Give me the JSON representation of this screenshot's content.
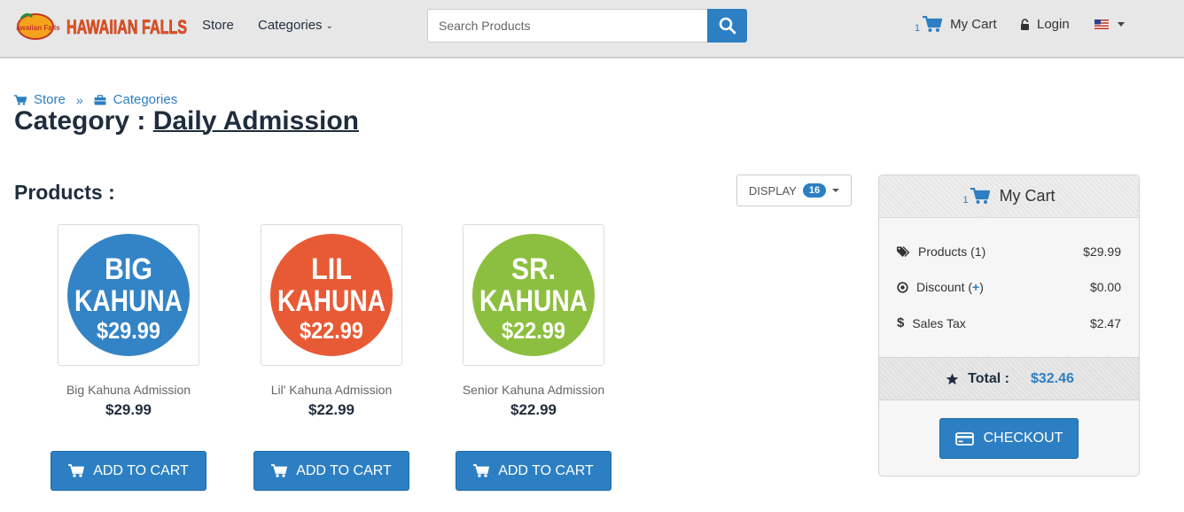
{
  "colors": {
    "accent": "#2c7fc2",
    "navbar_bg": "#e7e7e7",
    "big_kahuna": "#3384c6",
    "lil_kahuna": "#e85a35",
    "sr_kahuna": "#8cbf3f",
    "logo_text": "#e8531f"
  },
  "header": {
    "logo_text": "HAWAIIAN FALLS",
    "logo_badge": "Hawaiian Falls",
    "store_label": "Store",
    "categories_label": "Categories",
    "search_placeholder": "Search Products",
    "cart_count": "1",
    "cart_label": "My Cart",
    "login_label": "Login",
    "language_icon": "us-flag-icon"
  },
  "breadcrumb": {
    "store": "Store",
    "separator": "»",
    "categories": "Categories"
  },
  "page": {
    "title_prefix": "Category :",
    "category_name": "Daily Admission",
    "products_heading": "Products :",
    "display_label": "DISPLAY",
    "display_count": "16"
  },
  "products": [
    {
      "badge_line1": "BIG",
      "badge_line2": "KAHUNA",
      "badge_price": "$29.99",
      "name": "Big Kahuna Admission",
      "price": "$29.99",
      "button": "ADD TO CART"
    },
    {
      "badge_line1": "LIL",
      "badge_line2": "KAHUNA",
      "badge_price": "$22.99",
      "name": "Lil' Kahuna Admission",
      "price": "$22.99",
      "button": "ADD TO CART"
    },
    {
      "badge_line1": "SR.",
      "badge_line2": "KAHUNA",
      "badge_price": "$22.99",
      "name": "Senior Kahuna Admission",
      "price": "$22.99",
      "button": "ADD TO CART"
    }
  ],
  "cart": {
    "count": "1",
    "title": "My Cart",
    "products_label": "Products (1)",
    "products_value": "$29.99",
    "discount_label": "Discount (",
    "discount_plus": "+",
    "discount_close": ")",
    "discount_value": "$0.00",
    "tax_label": "Sales Tax",
    "tax_value": "$2.47",
    "total_label": "Total :",
    "total_value": "$32.46",
    "checkout_label": "CHECKOUT"
  }
}
